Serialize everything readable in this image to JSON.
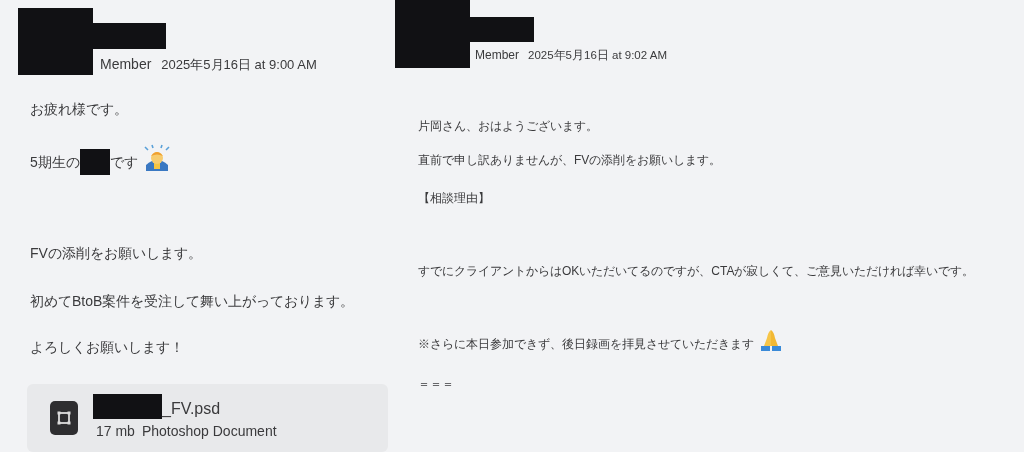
{
  "messages": [
    {
      "role": "Member",
      "timestamp": "2025年5月16日 at 9:00 AM",
      "paragraphs": [
        [
          {
            "kind": "text",
            "text": "お疲れ様です。"
          }
        ],
        [
          {
            "kind": "text",
            "text": "5期生の"
          },
          {
            "kind": "redaction"
          },
          {
            "kind": "text",
            "text": "です"
          },
          {
            "kind": "bow_emoji"
          }
        ],
        [
          {
            "kind": "text",
            "text": "FVの添削をお願いします。"
          }
        ],
        [
          {
            "kind": "text",
            "text": "初めてBtoB案件を受注して舞い上がっております。"
          }
        ],
        [
          {
            "kind": "text",
            "text": "よろしくお願いします！"
          }
        ]
      ],
      "attachment": {
        "name": [
          {
            "kind": "redaction"
          },
          {
            "kind": "text",
            "text": "_FV.psd"
          }
        ],
        "size": "17 mb",
        "type": "Photoshop Document"
      }
    },
    {
      "role": "Member",
      "timestamp": "2025年5月16日 at 9:02 AM",
      "paragraphs": [
        [
          {
            "kind": "text",
            "text": "片岡さん、おはようございます。"
          }
        ],
        [
          {
            "kind": "text",
            "text": "直前で申し訳ありませんが、FVの添削をお願いします。"
          }
        ],
        [
          {
            "kind": "text",
            "text": "【相談理由】"
          }
        ],
        [
          {
            "kind": "text",
            "text": "すでにクライアントからはOKいただいてるのですが、CTAが寂しくて、ご意見いただければ幸いです。"
          }
        ],
        [
          {
            "kind": "text",
            "text": "※さらに本日参加できず、後日録画を拝見させていただきます"
          },
          {
            "kind": "pray_emoji"
          }
        ],
        [
          {
            "kind": "text",
            "text": "＝＝＝"
          }
        ]
      ]
    }
  ]
}
